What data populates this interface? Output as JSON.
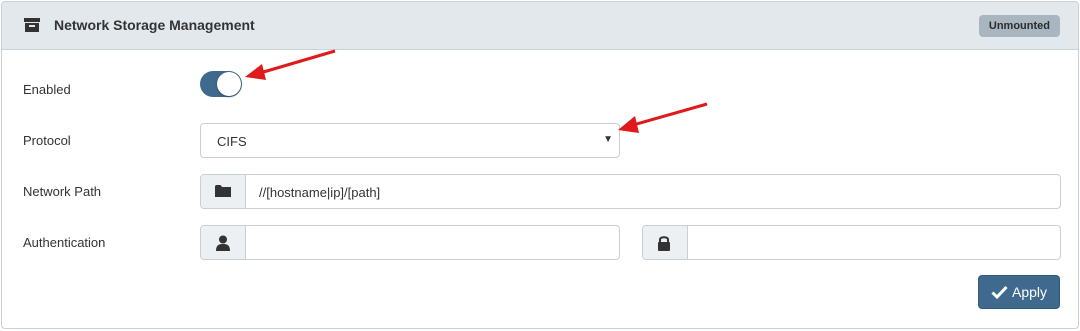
{
  "header": {
    "title": "Network Storage Management",
    "icon": "archive-icon",
    "status_badge": "Unmounted"
  },
  "form": {
    "enabled": {
      "label": "Enabled",
      "value": true
    },
    "protocol": {
      "label": "Protocol",
      "selected": "CIFS"
    },
    "network_path": {
      "label": "Network Path",
      "value": "//[hostname|ip]/[path]",
      "icon": "folder-icon"
    },
    "authentication": {
      "label": "Authentication",
      "username_value": "",
      "password_value": "",
      "user_icon": "user-icon",
      "lock_icon": "lock-icon"
    }
  },
  "actions": {
    "apply_label": "Apply"
  },
  "colors": {
    "accent": "#3f6a8e",
    "header_bg": "#e3e8ec",
    "badge_bg": "#a9b6c0",
    "annotation_arrow": "#e01a1a"
  }
}
